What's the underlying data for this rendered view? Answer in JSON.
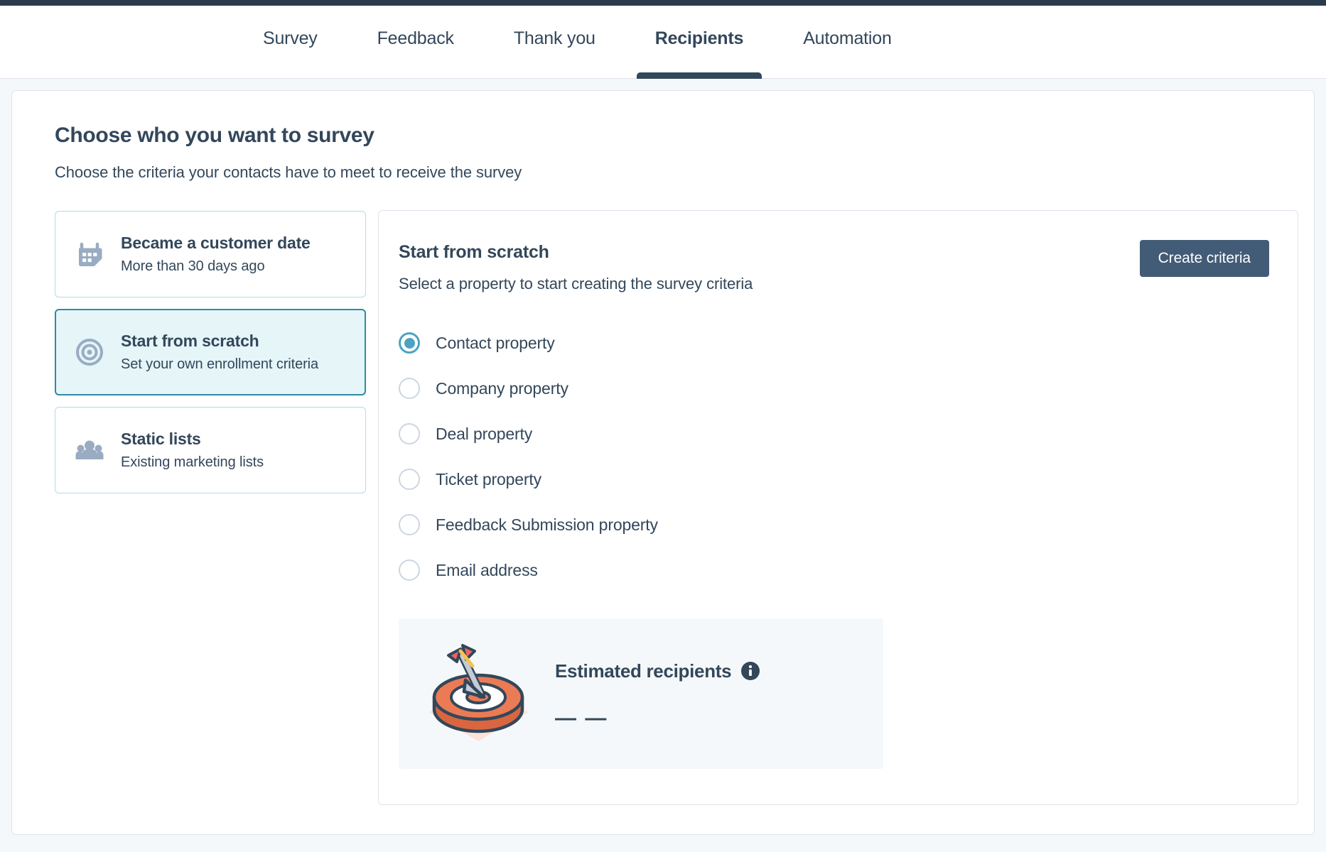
{
  "tabs": [
    {
      "label": "Survey",
      "active": false
    },
    {
      "label": "Feedback",
      "active": false
    },
    {
      "label": "Thank you",
      "active": false
    },
    {
      "label": "Recipients",
      "active": true
    },
    {
      "label": "Automation",
      "active": false
    }
  ],
  "page": {
    "title": "Choose who you want to survey",
    "subtitle": "Choose the criteria your contacts have to meet to receive the survey"
  },
  "options": [
    {
      "icon": "calendar-icon",
      "title": "Became a customer date",
      "subtitle": "More than 30 days ago",
      "selected": false
    },
    {
      "icon": "target-icon",
      "title": "Start from scratch",
      "subtitle": "Set your own enrollment criteria",
      "selected": true
    },
    {
      "icon": "people-icon",
      "title": "Static lists",
      "subtitle": "Existing marketing lists",
      "selected": false
    }
  ],
  "detail": {
    "title": "Start from scratch",
    "subtitle": "Select a property to start creating the survey criteria",
    "create_button_label": "Create criteria",
    "property_options": [
      {
        "label": "Contact property",
        "checked": true
      },
      {
        "label": "Company property",
        "checked": false
      },
      {
        "label": "Deal property",
        "checked": false
      },
      {
        "label": "Ticket property",
        "checked": false
      },
      {
        "label": "Feedback Submission property",
        "checked": false
      },
      {
        "label": "Email address",
        "checked": false
      }
    ],
    "estimate": {
      "title": "Estimated recipients",
      "value": "— —",
      "info_icon": "info-icon",
      "illustration": "dartboard-with-arrow-illustration"
    }
  },
  "colors": {
    "top_strip": "#2a3b4d",
    "text_primary": "#33475b",
    "accent_teal": "#4ba3c0",
    "selected_card_bg": "#e5f5f8",
    "selected_card_border": "#2e8ba4",
    "card_border": "#b3dbe5",
    "panel_border": "#dfe3eb",
    "button_bg": "#425b76",
    "page_bg": "#f5f8fa",
    "illustration_orange": "#eb7b55",
    "illustration_dark": "#33475b",
    "illustration_peach": "#fbe3d9"
  }
}
